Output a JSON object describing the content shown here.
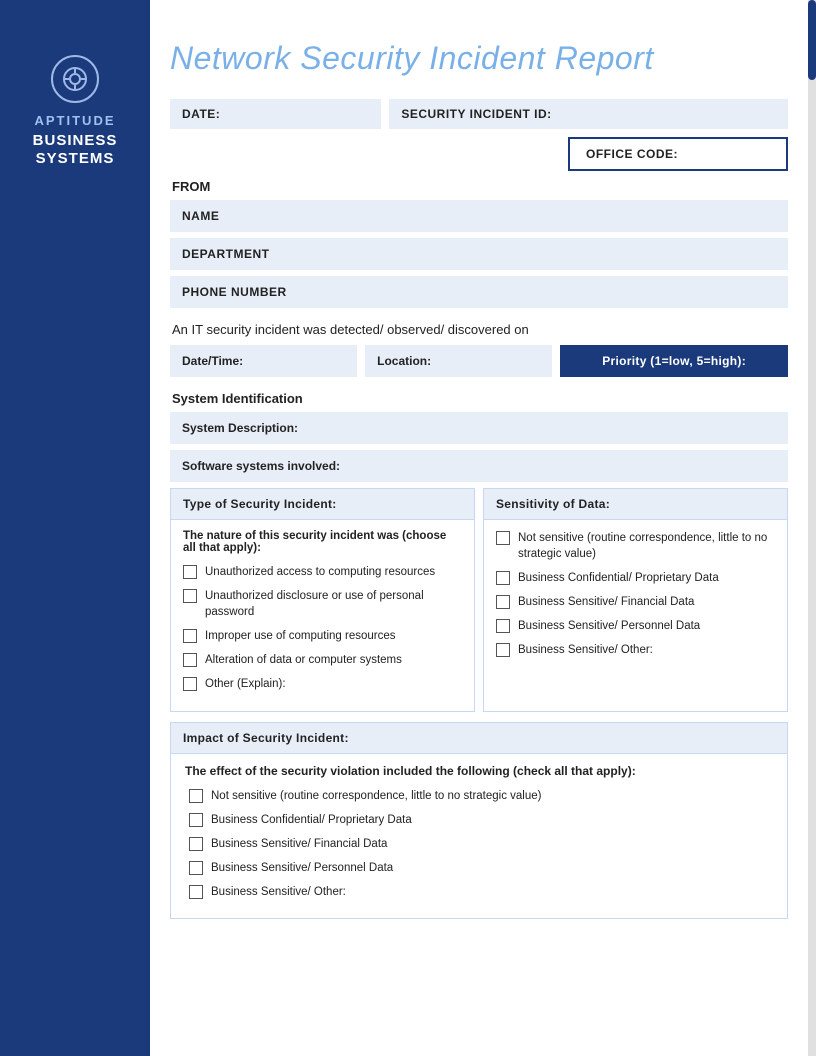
{
  "sidebar": {
    "company_name": "APTITUDE",
    "company_sub": "BUSINESS\nSYSTEMS"
  },
  "header": {
    "title": "Network Security Incident Report",
    "date_label": "DATE:",
    "incident_id_label": "SECURITY INCIDENT ID:",
    "office_code_label": "OFFICE CODE:"
  },
  "form": {
    "from_label": "FROM",
    "name_label": "NAME",
    "department_label": "DEPARTMENT",
    "phone_label": "PHONE NUMBER",
    "incident_description": "An IT security incident was detected/ observed/ discovered on",
    "date_time_label": "Date/Time:",
    "location_label": "Location:",
    "priority_label": "Priority (1=low, 5=high):",
    "system_identification_label": "System Identification",
    "system_description_label": "System Description:",
    "software_systems_label": "Software systems involved:"
  },
  "type_of_incident": {
    "header": "Type of Security Incident:",
    "sub_label": "The nature of this security incident was (choose all that apply):",
    "checkboxes": [
      "Unauthorized access to computing resources",
      "Unauthorized disclosure or use of personal password",
      "Improper use of computing resources",
      "Alteration of data or computer systems",
      "Other (Explain):"
    ]
  },
  "sensitivity": {
    "header": "Sensitivity of Data:",
    "checkboxes": [
      "Not sensitive (routine correspondence, little to no strategic value)",
      "Business Confidential/ Proprietary Data",
      "Business Sensitive/ Financial Data",
      "Business Sensitive/ Personnel Data",
      "Business Sensitive/ Other:"
    ]
  },
  "impact": {
    "header": "Impact of Security Incident:",
    "subtitle": "The effect of the security violation included the following (check all that apply):",
    "checkboxes": [
      "Not sensitive (routine correspondence, little to no strategic value)",
      "Business Confidential/ Proprietary Data",
      "Business Sensitive/ Financial Data",
      "Business Sensitive/ Personnel Data",
      "Business Sensitive/ Other:"
    ]
  }
}
